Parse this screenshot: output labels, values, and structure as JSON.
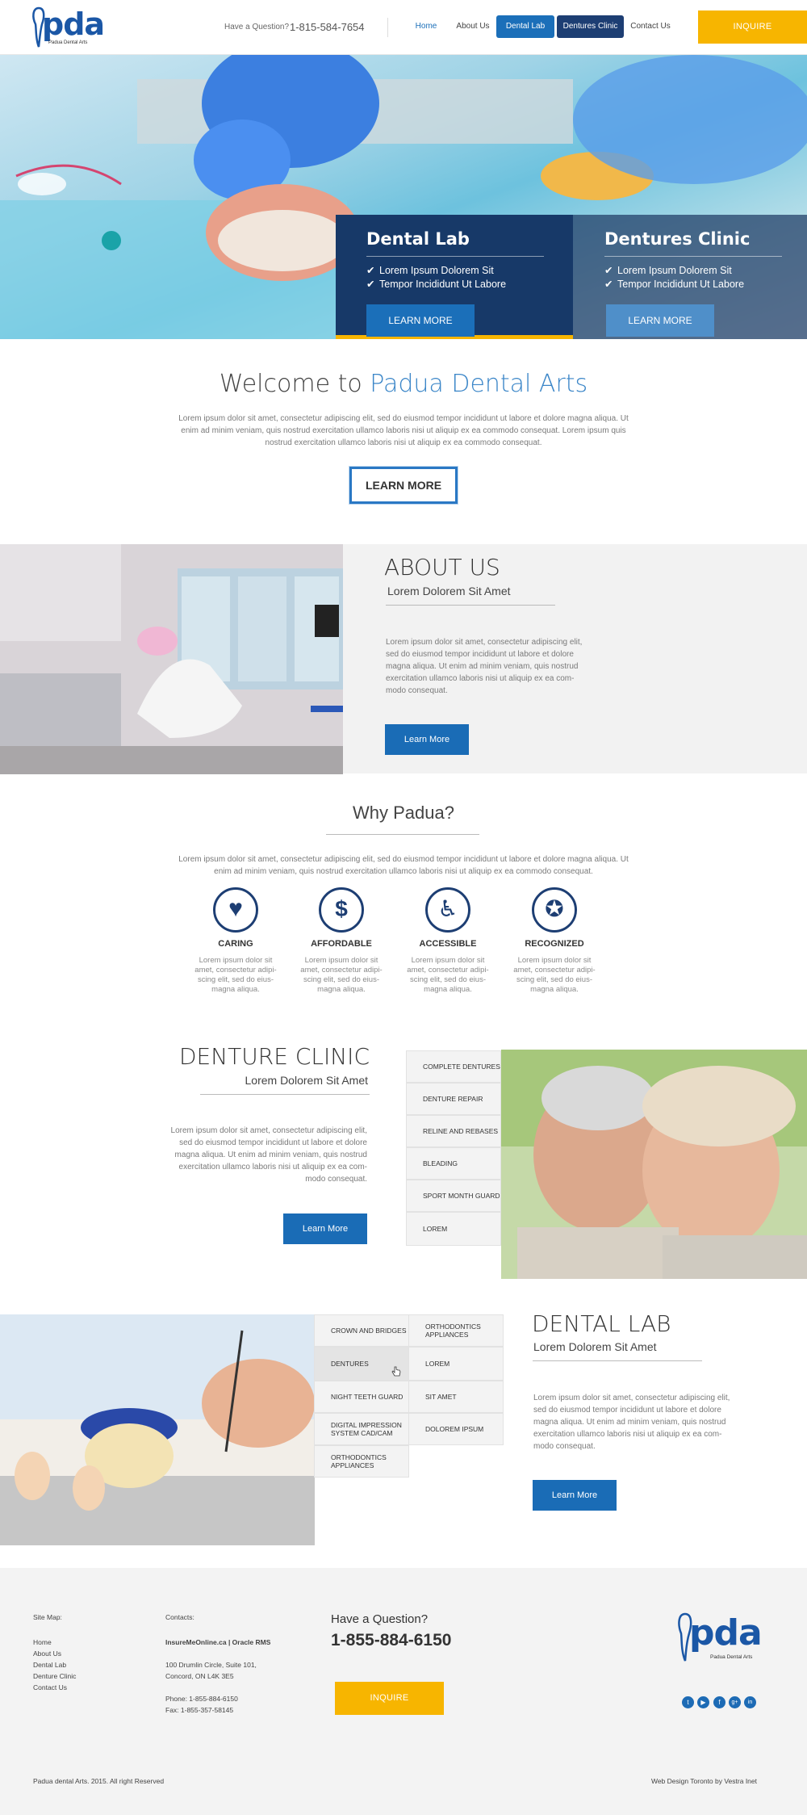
{
  "header": {
    "logo_text": "pda",
    "logo_tagline": "Padua Dental Arts",
    "question_label": "Have a Question?",
    "phone": "1-815-584-7654",
    "nav": [
      "Home",
      "About Us",
      "Dental Lab",
      "Dentures Clinic",
      "Contact Us"
    ],
    "inquire_label": "INQUIRE"
  },
  "hero": {
    "panels": [
      {
        "title": "Dental Lab",
        "bullets": [
          "Lorem Ipsum Dolorem Sit",
          "Tempor Incididunt Ut Labore"
        ],
        "button": "LEARN MORE"
      },
      {
        "title": "Dentures Clinic",
        "bullets": [
          "Lorem Ipsum Dolorem Sit",
          "Tempor Incididunt Ut Labore"
        ],
        "button": "LEARN MORE"
      }
    ],
    "check_glyph": "✔"
  },
  "welcome": {
    "title_prefix": "Welcome to ",
    "title_brand": "Padua Dental Arts",
    "text": "Lorem ipsum dolor sit amet, consectetur adipiscing elit, sed do eiusmod tempor incididunt ut labore et dolore magna aliqua. Ut enim ad minim veniam, quis nostrud exercitation ullamco laboris nisi ut aliquip ex ea commodo consequat. Lorem ipsum quis nostrud exercitation ullamco laboris nisi ut aliquip ex ea commodo consequat.",
    "button": "LEARN MORE"
  },
  "about": {
    "title": "ABOUT US",
    "subtitle": "Lorem Dolorem Sit Amet",
    "text": "Lorem ipsum dolor sit amet, consectetur adipiscing elit, sed do eiusmod tempor incididunt ut labore et dolore magna aliqua. Ut enim ad minim veniam, quis nostrud exercitation ullamco laboris nisi ut aliquip ex ea com-modo consequat.",
    "button": "Learn More"
  },
  "why": {
    "title": "Why Padua?",
    "text": "Lorem ipsum dolor sit amet, consectetur adipiscing elit, sed do eiusmod tempor incididunt ut labore et dolore magna aliqua. Ut enim ad minim veniam, quis nostrud exercitation ullamco laboris nisi ut aliquip ex ea commodo consequat.",
    "features": [
      {
        "title": "CARING",
        "icon": "heart-icon",
        "glyph": "♥",
        "text": "Lorem ipsum dolor sit amet, consectetur adipi-scing elit, sed do eius-magna aliqua."
      },
      {
        "title": "AFFORDABLE",
        "icon": "dollar-icon",
        "glyph": "$",
        "text": "Lorem ipsum dolor sit amet, consectetur adipi-scing elit, sed do eius-magna aliqua."
      },
      {
        "title": "ACCESSIBLE",
        "icon": "wheelchair-icon",
        "glyph": "♿",
        "text": "Lorem ipsum dolor sit amet, consectetur adipi-scing elit, sed do eius-magna aliqua."
      },
      {
        "title": "RECOGNIZED",
        "icon": "award-icon",
        "glyph": "✪",
        "text": "Lorem ipsum dolor sit amet, consectetur adipi-scing elit, sed do eius-magna aliqua."
      }
    ]
  },
  "denture_clinic": {
    "title": "DENTURE CLINIC",
    "subtitle": "Lorem Dolorem Sit Amet",
    "text": "Lorem ipsum dolor sit amet, consectetur adipiscing elit, sed do eiusmod tempor incididunt ut labore et dolore magna aliqua. Ut enim ad minim veniam, quis nostrud exercitation ullamco laboris nisi ut aliquip ex ea com-modo consequat.",
    "button": "Learn More",
    "services": [
      "COMPLETE DENTURES",
      "DENTURE REPAIR",
      "RELINE AND REBASES",
      "BLEADING",
      "SPORT MONTH GUARD",
      "LOREM"
    ]
  },
  "dental_lab": {
    "title": "DENTAL LAB",
    "subtitle": "Lorem Dolorem Sit Amet",
    "text": "Lorem ipsum dolor sit amet, consectetur adipiscing elit, sed do eiusmod tempor incididunt ut labore et dolore magna aliqua. Ut enim ad minim veniam, quis nostrud exercitation ullamco laboris nisi ut aliquip ex ea com-modo consequat.",
    "button": "Learn More",
    "services_left": [
      "CROWN AND BRIDGES",
      "DENTURES",
      "NIGHT TEETH GUARD",
      "DIGITAL IMPRESSION SYSTEM CAD/CAM",
      "ORTHODONTICS APPLIANCES"
    ],
    "services_right": [
      "ORTHODONTICS APPLIANCES",
      "LOREM",
      "SIT AMET",
      "DOLOREM IPSUM"
    ]
  },
  "footer": {
    "sitemap_title": "Site Map:",
    "sitemap": [
      "Home",
      "About Us",
      "Dental Lab",
      "Denture Clinic",
      "Contact Us"
    ],
    "contacts_title": "Contacts:",
    "contacts_company": "InsureMeOnline.ca | Oracle RMS",
    "address_line1": "100 Drumlin Circle, Suite 101,",
    "address_line2": "Concord, ON L4K 3E5",
    "phone_line": "Phone: 1-855-884-6150",
    "fax_line": "Fax: 1-855-357-58145",
    "question": "Have a Question?",
    "phone_big": "1-855-884-6150",
    "inquire_label": "INQUIRE",
    "logo_text": "pda",
    "logo_tagline": "Padua Dental Arts",
    "social": [
      "twitter-icon",
      "youtube-icon",
      "facebook-icon",
      "google-plus-icon",
      "linkedin-icon"
    ],
    "social_glyphs": [
      "t",
      "▶",
      "f",
      "g+",
      "in"
    ],
    "copyright": "Padua dental Arts. 2015. All right Reserved",
    "credit": "Web Design Toronto by Vestra Inet"
  },
  "colors": {
    "brand_blue": "#1b57a6",
    "navy": "#1d3e73",
    "accent_yellow": "#f7b500",
    "button_blue": "#1a6cb6"
  }
}
